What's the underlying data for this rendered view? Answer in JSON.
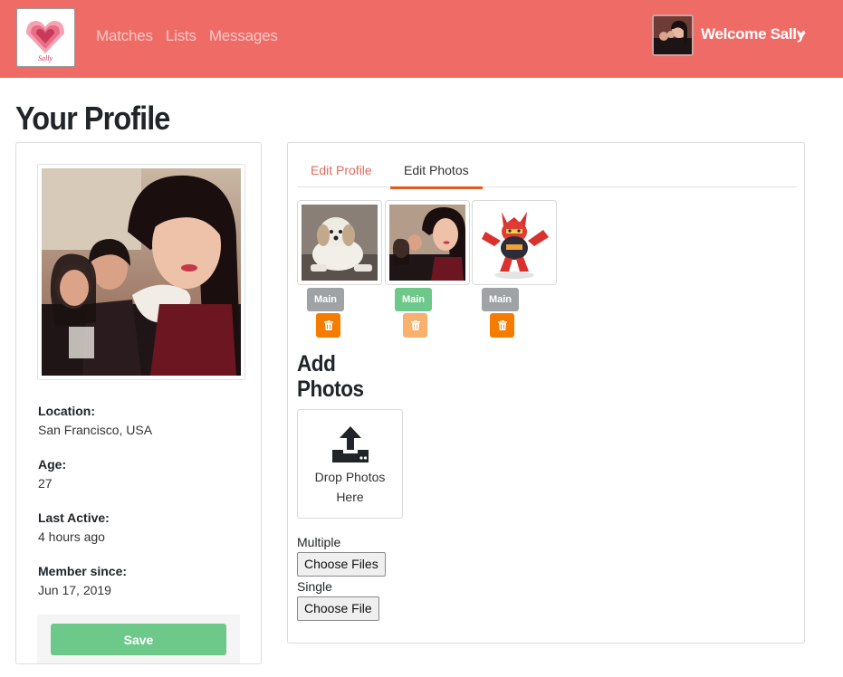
{
  "nav": {
    "logo_text": "Sally",
    "links": [
      "Matches",
      "Lists",
      "Messages"
    ],
    "welcome": "Welcome Sally"
  },
  "page": {
    "title": "Your Profile"
  },
  "profile": {
    "fields": [
      {
        "label": "Location:",
        "value": "San Francisco, USA"
      },
      {
        "label": "Age:",
        "value": "27"
      },
      {
        "label": "Last Active:",
        "value": "4 hours ago"
      },
      {
        "label": "Member since:",
        "value": "Jun 17, 2019"
      }
    ],
    "save_label": "Save"
  },
  "tabs": {
    "edit_profile": "Edit Profile",
    "edit_photos": "Edit Photos",
    "active": "Edit Photos"
  },
  "photos": [
    {
      "subject": "dog",
      "main_label": "Main",
      "is_main": false
    },
    {
      "subject": "girls",
      "main_label": "Main",
      "is_main": true
    },
    {
      "subject": "monster",
      "main_label": "Main",
      "is_main": false
    }
  ],
  "upload": {
    "title_line1": "Add",
    "title_line2": "Photos",
    "drop_line1": "Drop Photos",
    "drop_line2": "Here",
    "multiple_label": "Multiple",
    "multiple_button": "Choose Files",
    "single_label": "Single",
    "single_button": "Choose File"
  },
  "colors": {
    "navbar": "#ef6b66",
    "accent_orange": "#f57c00",
    "success_green": "#6dc98a",
    "tab_active": "#e35a1e"
  },
  "icons": [
    "heart-logo-icon",
    "trash-icon",
    "upload-icon",
    "caret-down-icon"
  ]
}
